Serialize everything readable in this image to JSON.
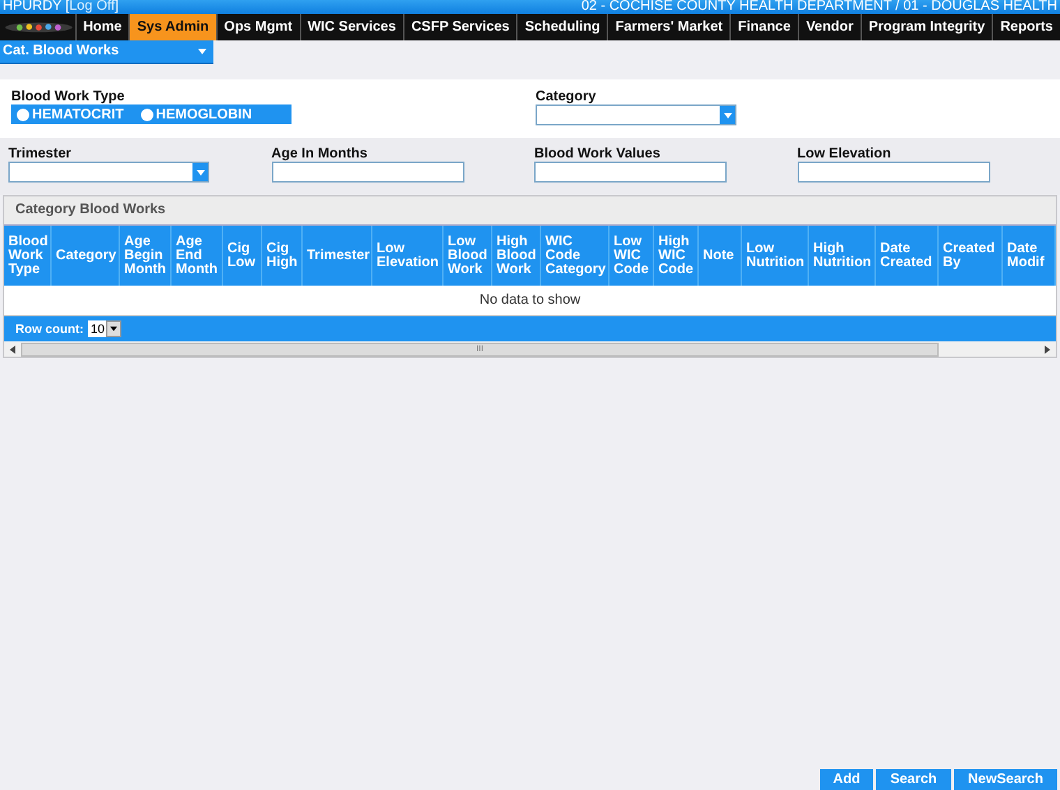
{
  "top_bar": {
    "user": "HPURDY",
    "open_bracket": "[",
    "logoff": "Log Off",
    "close_bracket": "]",
    "agency": "02 - COCHISE COUNTY HEALTH DEPARTMENT / 01 - DOUGLAS HEALTH"
  },
  "nav": [
    {
      "label": "Home",
      "selected": false
    },
    {
      "label": "Sys Admin",
      "selected": true
    },
    {
      "label": "Ops Mgmt",
      "selected": false
    },
    {
      "label": "WIC Services",
      "selected": false
    },
    {
      "label": "CSFP Services",
      "selected": false
    },
    {
      "label": "Scheduling",
      "selected": false
    },
    {
      "label": "Farmers' Market",
      "selected": false
    },
    {
      "label": "Finance",
      "selected": false
    },
    {
      "label": "Vendor",
      "selected": false
    },
    {
      "label": "Program Integrity",
      "selected": false
    },
    {
      "label": "Reports",
      "selected": false
    }
  ],
  "page_menu": {
    "value": "Cat. Blood Works"
  },
  "blood_work_type": {
    "label": "Blood Work Type",
    "options": [
      {
        "label": "HEMATOCRIT",
        "selected": false
      },
      {
        "label": "HEMOGLOBIN",
        "selected": false
      }
    ]
  },
  "category": {
    "label": "Category"
  },
  "filters": [
    {
      "label": "Trimester",
      "kind": "select"
    },
    {
      "label": "Age In Months",
      "kind": "text"
    },
    {
      "label": "Blood Work Values",
      "kind": "text"
    },
    {
      "label": "Low Elevation",
      "kind": "text"
    }
  ],
  "grid": {
    "title": "Category Blood Works",
    "columns": [
      "Blood Work Type",
      "Category",
      "Age Begin Month",
      "Age End Month",
      "Cig Low",
      "Cig High",
      "Trimester",
      "Low Elevation",
      "Low Blood Work",
      "High Blood Work",
      "WIC Code Category",
      "Low WIC Code",
      "High WIC Code",
      "Note",
      "Low Nutrition",
      "High Nutrition",
      "Date Created",
      "Created By",
      "Date Modif"
    ],
    "empty": "No data to show",
    "row_count_label": "Row count:",
    "row_count": "10",
    "scroll_grip": "III"
  },
  "buttons": [
    "Add",
    "Search",
    "NewSearch"
  ]
}
